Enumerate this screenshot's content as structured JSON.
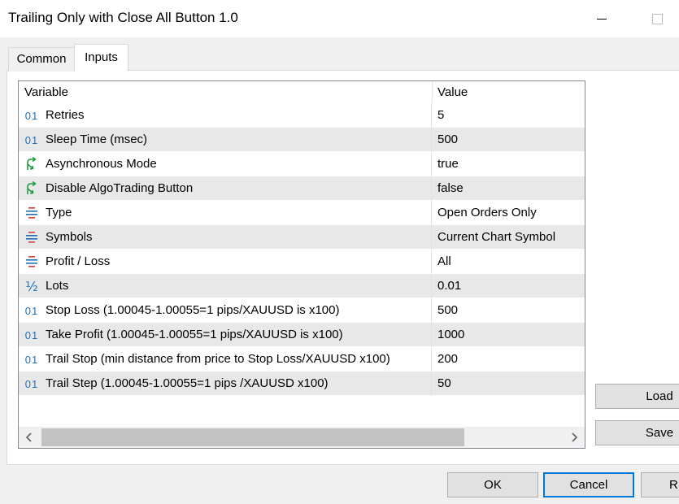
{
  "window": {
    "title": "Trailing Only with Close All Button 1.0"
  },
  "tabs": [
    {
      "label": "Common"
    },
    {
      "label": "Inputs"
    }
  ],
  "grid": {
    "columns": {
      "variable": "Variable",
      "value": "Value"
    },
    "rows": [
      {
        "icon": "int-icon",
        "icon_text": "01",
        "variable": "Retries",
        "value": "5"
      },
      {
        "icon": "int-icon",
        "icon_text": "01",
        "variable": "Sleep Time (msec)",
        "value": "500"
      },
      {
        "icon": "bool-icon",
        "icon_text": "",
        "variable": "Asynchronous Mode",
        "value": "true"
      },
      {
        "icon": "bool-icon",
        "icon_text": "",
        "variable": "Disable AlgoTrading Button",
        "value": "false"
      },
      {
        "icon": "enum-icon",
        "icon_text": "",
        "variable": "Type",
        "value": "Open Orders Only"
      },
      {
        "icon": "enum-icon",
        "icon_text": "",
        "variable": "Symbols",
        "value": "Current Chart Symbol"
      },
      {
        "icon": "enum-icon",
        "icon_text": "",
        "variable": "Profit / Loss",
        "value": "All"
      },
      {
        "icon": "double-icon",
        "icon_text": "½",
        "variable": "Lots",
        "value": "0.01"
      },
      {
        "icon": "int-icon",
        "icon_text": "01",
        "variable": "Stop Loss (1.00045-1.00055=1 pips/XAUUSD is x100)",
        "value": "500"
      },
      {
        "icon": "int-icon",
        "icon_text": "01",
        "variable": "Take Profit (1.00045-1.00055=1 pips/XAUUSD is x100)",
        "value": "1000"
      },
      {
        "icon": "int-icon",
        "icon_text": "01",
        "variable": "Trail Stop (min distance from price to Stop Loss/XAUUSD x100)",
        "value": "200"
      },
      {
        "icon": "int-icon",
        "icon_text": "01",
        "variable": "Trail Step (1.00045-1.00055=1 pips /XAUUSD x100)",
        "value": "50"
      }
    ]
  },
  "buttons": {
    "load": "Load",
    "save": "Save",
    "ok": "OK",
    "cancel": "Cancel",
    "reset": "R"
  },
  "colors": {
    "accent": "#0078d7",
    "icon_blue": "#1e6fb8",
    "icon_green": "#1e9e3e",
    "icon_red": "#d83b3b"
  }
}
